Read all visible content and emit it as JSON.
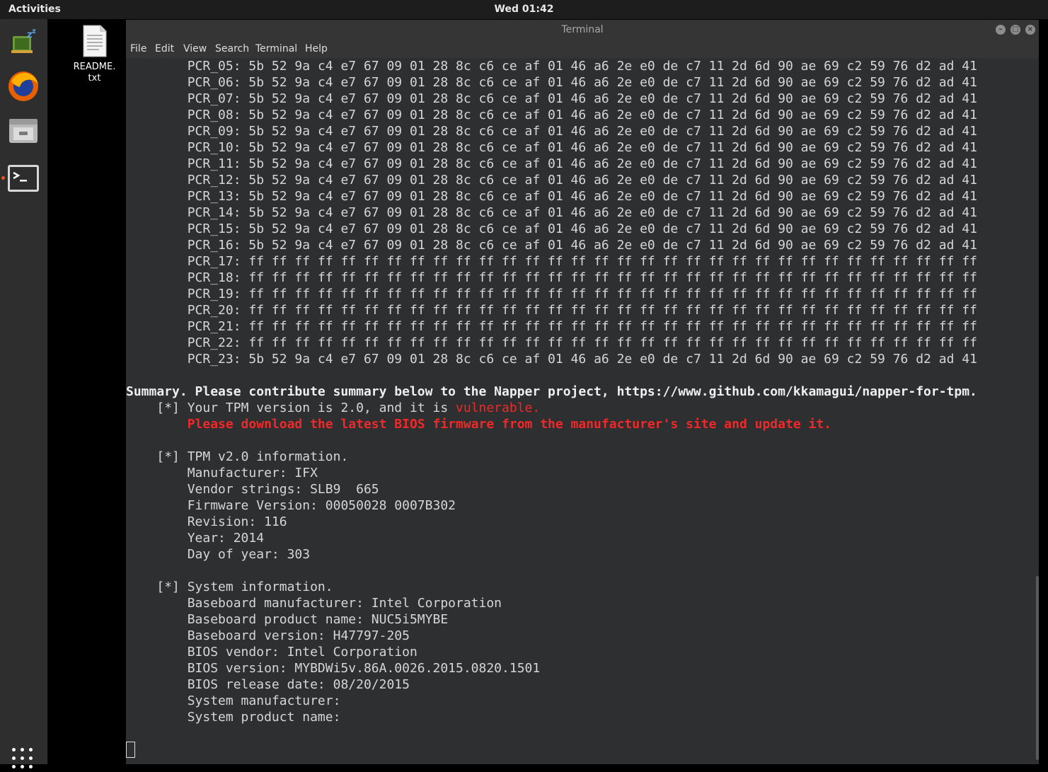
{
  "topbar": {
    "activities": "Activities",
    "clock": "Wed 01:42"
  },
  "dock": {
    "items": [
      {
        "name": "hardinfo",
        "icon": "system-monitor-icon"
      },
      {
        "name": "firefox",
        "icon": "firefox-icon"
      },
      {
        "name": "files",
        "icon": "files-icon"
      },
      {
        "name": "terminal",
        "icon": "terminal-icon",
        "running": true
      }
    ],
    "apps_grid": "show-applications-icon"
  },
  "desktop": {
    "file_label_line1": "README.",
    "file_label_line2": "txt"
  },
  "window": {
    "title": "Terminal",
    "menu": [
      "File",
      "Edit",
      "View",
      "Search",
      "Terminal",
      "Help"
    ]
  },
  "terminal": {
    "pcr_rows": [
      {
        "label": "PCR_05:",
        "hex": "5b 52 9a c4 e7 67 09 01 28 8c c6 ce af 01 46 a6 2e e0 de c7 11 2d 6d 90 ae 69 c2 59 76 d2 ad 41"
      },
      {
        "label": "PCR_06:",
        "hex": "5b 52 9a c4 e7 67 09 01 28 8c c6 ce af 01 46 a6 2e e0 de c7 11 2d 6d 90 ae 69 c2 59 76 d2 ad 41"
      },
      {
        "label": "PCR_07:",
        "hex": "5b 52 9a c4 e7 67 09 01 28 8c c6 ce af 01 46 a6 2e e0 de c7 11 2d 6d 90 ae 69 c2 59 76 d2 ad 41"
      },
      {
        "label": "PCR_08:",
        "hex": "5b 52 9a c4 e7 67 09 01 28 8c c6 ce af 01 46 a6 2e e0 de c7 11 2d 6d 90 ae 69 c2 59 76 d2 ad 41"
      },
      {
        "label": "PCR_09:",
        "hex": "5b 52 9a c4 e7 67 09 01 28 8c c6 ce af 01 46 a6 2e e0 de c7 11 2d 6d 90 ae 69 c2 59 76 d2 ad 41"
      },
      {
        "label": "PCR_10:",
        "hex": "5b 52 9a c4 e7 67 09 01 28 8c c6 ce af 01 46 a6 2e e0 de c7 11 2d 6d 90 ae 69 c2 59 76 d2 ad 41"
      },
      {
        "label": "PCR_11:",
        "hex": "5b 52 9a c4 e7 67 09 01 28 8c c6 ce af 01 46 a6 2e e0 de c7 11 2d 6d 90 ae 69 c2 59 76 d2 ad 41"
      },
      {
        "label": "PCR_12:",
        "hex": "5b 52 9a c4 e7 67 09 01 28 8c c6 ce af 01 46 a6 2e e0 de c7 11 2d 6d 90 ae 69 c2 59 76 d2 ad 41"
      },
      {
        "label": "PCR_13:",
        "hex": "5b 52 9a c4 e7 67 09 01 28 8c c6 ce af 01 46 a6 2e e0 de c7 11 2d 6d 90 ae 69 c2 59 76 d2 ad 41"
      },
      {
        "label": "PCR_14:",
        "hex": "5b 52 9a c4 e7 67 09 01 28 8c c6 ce af 01 46 a6 2e e0 de c7 11 2d 6d 90 ae 69 c2 59 76 d2 ad 41"
      },
      {
        "label": "PCR_15:",
        "hex": "5b 52 9a c4 e7 67 09 01 28 8c c6 ce af 01 46 a6 2e e0 de c7 11 2d 6d 90 ae 69 c2 59 76 d2 ad 41"
      },
      {
        "label": "PCR_16:",
        "hex": "5b 52 9a c4 e7 67 09 01 28 8c c6 ce af 01 46 a6 2e e0 de c7 11 2d 6d 90 ae 69 c2 59 76 d2 ad 41"
      },
      {
        "label": "PCR_17:",
        "hex": "ff ff ff ff ff ff ff ff ff ff ff ff ff ff ff ff ff ff ff ff ff ff ff ff ff ff ff ff ff ff ff ff"
      },
      {
        "label": "PCR_18:",
        "hex": "ff ff ff ff ff ff ff ff ff ff ff ff ff ff ff ff ff ff ff ff ff ff ff ff ff ff ff ff ff ff ff ff"
      },
      {
        "label": "PCR_19:",
        "hex": "ff ff ff ff ff ff ff ff ff ff ff ff ff ff ff ff ff ff ff ff ff ff ff ff ff ff ff ff ff ff ff ff"
      },
      {
        "label": "PCR_20:",
        "hex": "ff ff ff ff ff ff ff ff ff ff ff ff ff ff ff ff ff ff ff ff ff ff ff ff ff ff ff ff ff ff ff ff"
      },
      {
        "label": "PCR_21:",
        "hex": "ff ff ff ff ff ff ff ff ff ff ff ff ff ff ff ff ff ff ff ff ff ff ff ff ff ff ff ff ff ff ff ff"
      },
      {
        "label": "PCR_22:",
        "hex": "ff ff ff ff ff ff ff ff ff ff ff ff ff ff ff ff ff ff ff ff ff ff ff ff ff ff ff ff ff ff ff ff"
      },
      {
        "label": "PCR_23:",
        "hex": "5b 52 9a c4 e7 67 09 01 28 8c c6 ce af 01 46 a6 2e e0 de c7 11 2d 6d 90 ae 69 c2 59 76 d2 ad 41"
      }
    ],
    "summary_line": "Summary. Please contribute summary below to the Napper project, https://www.github.com/kkamagui/napper-for-tpm.",
    "vuln_prefix": "[*] Your TPM version is 2.0, and it is ",
    "vuln_word": "vulnerable.",
    "vuln_advice": "Please download the latest BIOS firmware from the manufacturer's site and update it.",
    "tpm_header": "[*] TPM v2.0 information.",
    "tpm_info": [
      "Manufacturer: IFX",
      "Vendor strings: SLB9  665",
      "Firmware Version: 00050028 0007B302",
      "Revision: 116",
      "Year: 2014",
      "Day of year: 303"
    ],
    "sys_header": "[*] System information.",
    "sys_info": [
      "Baseboard manufacturer: Intel Corporation",
      "Baseboard product name: NUC5i5MYBE",
      "Baseboard version: H47797-205",
      "BIOS vendor: Intel Corporation",
      "BIOS version: MYBDWi5v.86A.0026.2015.0820.1501",
      "BIOS release date: 08/20/2015",
      "System manufacturer:",
      "System product name:"
    ]
  },
  "colors": {
    "warning": "#ef2929",
    "terminal_bg": "#2e2f30",
    "accent": "#e95420"
  }
}
